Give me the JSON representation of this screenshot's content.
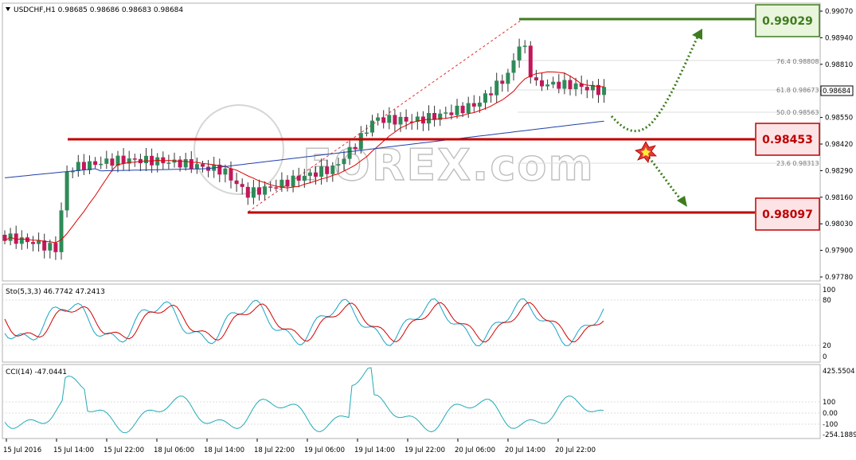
{
  "main": {
    "header": "USDCHF,H1  0.98685 0.98686 0.98683 0.98684",
    "price_labels": [
      "0.99070",
      "0.98940",
      "0.98810",
      "0.98680",
      "0.98550",
      "0.98420",
      "0.98290",
      "0.98160",
      "0.98030",
      "0.97900",
      "0.97780"
    ],
    "current_price": "0.98684",
    "fib_labels": {
      "f764": "76.4  0.98808",
      "f618": "61.8  0.98673",
      "f500": "50.0  0.98563",
      "f236": "23.6  0.98313"
    },
    "levels": {
      "resistance": "0.99029",
      "support1": "0.98453",
      "support2": "0.98097"
    },
    "watermark": "FOREX.com"
  },
  "stoch": {
    "header": "Sto(5,3,3) 46.7742 47.2413",
    "labels": [
      "100",
      "80",
      "20",
      "0"
    ]
  },
  "cci": {
    "header": "CCI(14) -47.0441",
    "labels": [
      "425.5504",
      "100",
      "0.00",
      "-100",
      "-254.1889"
    ]
  },
  "time_labels": [
    "15 Jul 2016",
    "15 Jul 14:00",
    "15 Jul 22:00",
    "18 Jul 06:00",
    "18 Jul 14:00",
    "18 Jul 22:00",
    "19 Jul 06:00",
    "19 Jul 14:00",
    "19 Jul 22:00",
    "20 Jul 06:00",
    "20 Jul 14:00",
    "20 Jul 22:00"
  ],
  "colors": {
    "bull_candle": "#2e8b57",
    "bear_candle": "#c2185b",
    "ma_fast": "#e00000",
    "ma_slow": "#1f3faa",
    "stoch_main": "#1aa3c7",
    "stoch_signal": "#d40000",
    "cci_line": "#22aab5",
    "support_line": "#c00000",
    "resistance_line": "#3e7d1e",
    "arrow": "#3e7d1e"
  }
}
